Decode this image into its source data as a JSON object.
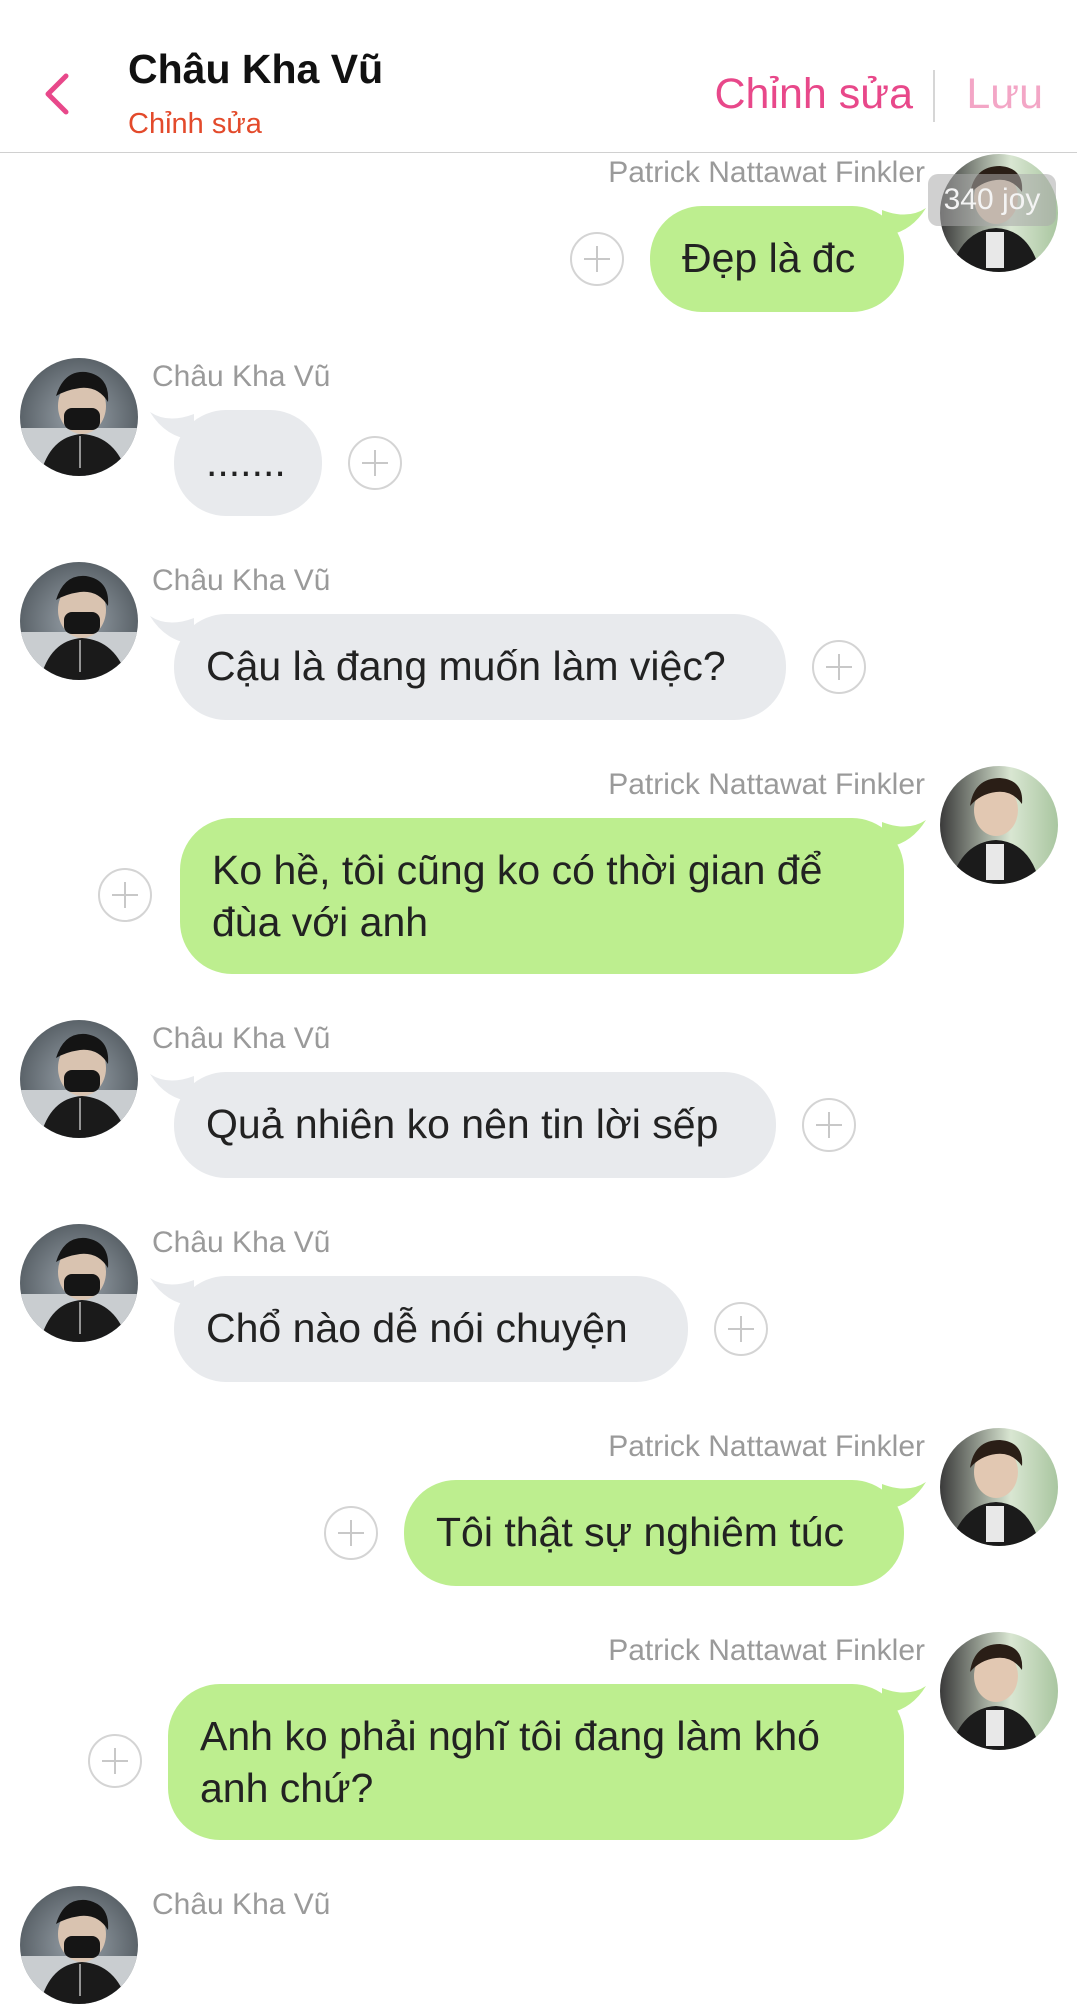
{
  "header": {
    "title": "Châu Kha Vũ",
    "subtitle": "Chỉnh sửa",
    "edit_label": "Chỉnh sửa",
    "save_label": "Lưu"
  },
  "badge": "340 joy",
  "colors": {
    "accent": "#e8488a",
    "subtitle": "#e34a2b",
    "save_disabled": "#f3a6c6",
    "bubble_left": "#e8eaed",
    "bubble_right": "#bdee8f"
  },
  "messages": [
    {
      "sender": "Patrick Nattawat Finkler",
      "side": "right",
      "text": "Đẹp là đc"
    },
    {
      "sender": "Châu Kha Vũ",
      "side": "left",
      "text": "......."
    },
    {
      "sender": "Châu Kha Vũ",
      "side": "left",
      "text": "Cậu là đang muốn làm việc?"
    },
    {
      "sender": "Patrick Nattawat Finkler",
      "side": "right",
      "text": "Ko hề, tôi cũng ko có thời gian để đùa với anh"
    },
    {
      "sender": "Châu Kha Vũ",
      "side": "left",
      "text": "Quả nhiên ko nên tin lời sếp"
    },
    {
      "sender": "Châu Kha Vũ",
      "side": "left",
      "text": "Chổ nào dễ nói chuyện"
    },
    {
      "sender": "Patrick Nattawat Finkler",
      "side": "right",
      "text": "Tôi thật sự nghiêm túc"
    },
    {
      "sender": "Patrick Nattawat Finkler",
      "side": "right",
      "text": "Anh ko phải nghĩ tôi đang làm khó anh chứ?"
    },
    {
      "sender": "Châu Kha Vũ",
      "side": "left",
      "text": ""
    }
  ]
}
